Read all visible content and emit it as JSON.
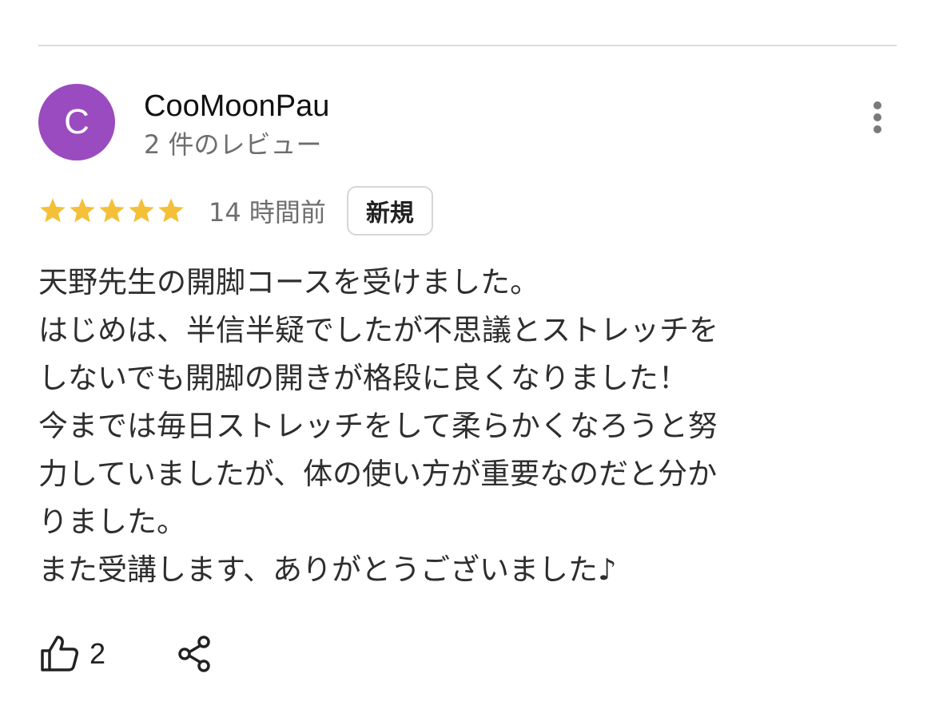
{
  "review": {
    "avatar_letter": "C",
    "avatar_color": "#9a4bbf",
    "reviewer_name": "CooMoonPau",
    "review_count": "2 件のレビュー",
    "rating": 5,
    "rating_max": 5,
    "star_color": "#f4c038",
    "time_ago": "14 時間前",
    "badge": "新規",
    "body": "天野先生の開脚コースを受けました。\nはじめは、半信半疑でしたが不思議とストレッチを\nしないでも開脚の開きが格段に良くなりました！\n今までは毎日ストレッチをして柔らかくなろうと努\n力していましたが、体の使い方が重要なのだと分か\nりました。\nまた受講します、ありがとうございました♪",
    "like_count": "2"
  },
  "icons": {
    "more": "more-vert-icon",
    "like": "thumb-up-icon",
    "share": "share-icon",
    "star": "star-icon"
  }
}
